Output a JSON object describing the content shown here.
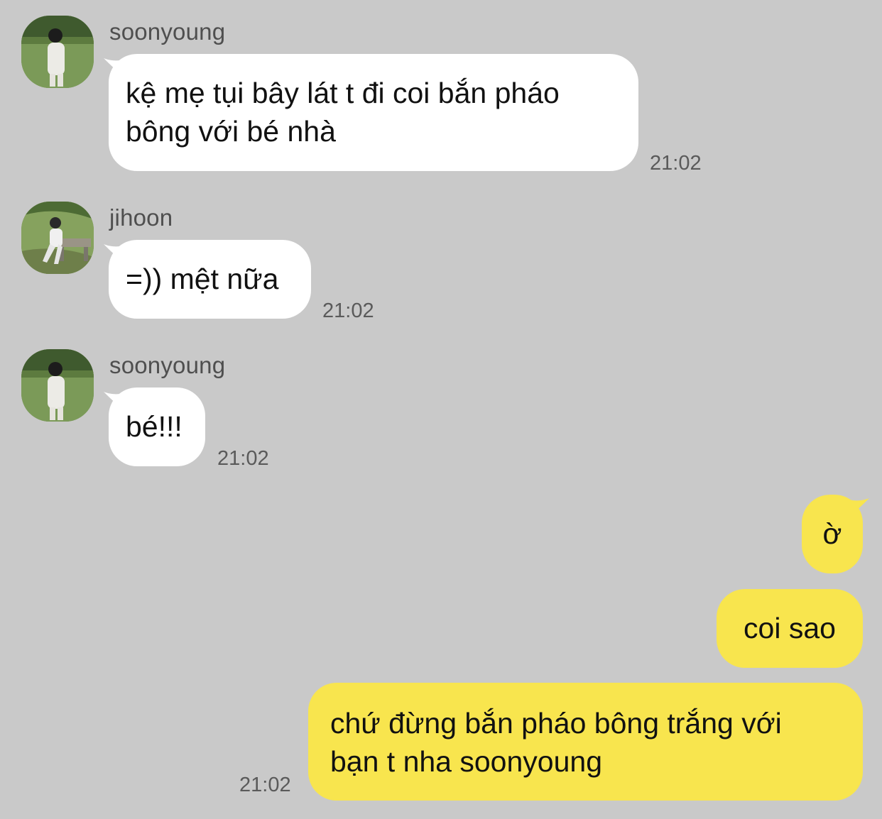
{
  "colors": {
    "background": "#c9c9c9",
    "incoming_bubble": "#ffffff",
    "outgoing_bubble": "#f8e54e"
  },
  "messages": [
    {
      "sender": "soonyoung",
      "lines": [
        "kệ mẹ tụi bây lát t đi coi bắn pháo",
        "bông với bé nhà"
      ],
      "time": "21:02",
      "direction": "incoming",
      "avatar": "avatar-soonyoung"
    },
    {
      "sender": "jihoon",
      "lines": [
        "=)) mệt nữa"
      ],
      "time": "21:02",
      "direction": "incoming",
      "avatar": "avatar-jihoon"
    },
    {
      "sender": "soonyoung",
      "lines": [
        "bé!!!"
      ],
      "time": "21:02",
      "direction": "incoming",
      "avatar": "avatar-soonyoung"
    },
    {
      "lines": [
        "ờ"
      ],
      "direction": "outgoing"
    },
    {
      "lines": [
        "coi sao"
      ],
      "direction": "outgoing"
    },
    {
      "lines": [
        "chứ đừng bắn pháo bông trắng với",
        "bạn t nha soonyoung"
      ],
      "time": "21:02",
      "direction": "outgoing"
    }
  ]
}
